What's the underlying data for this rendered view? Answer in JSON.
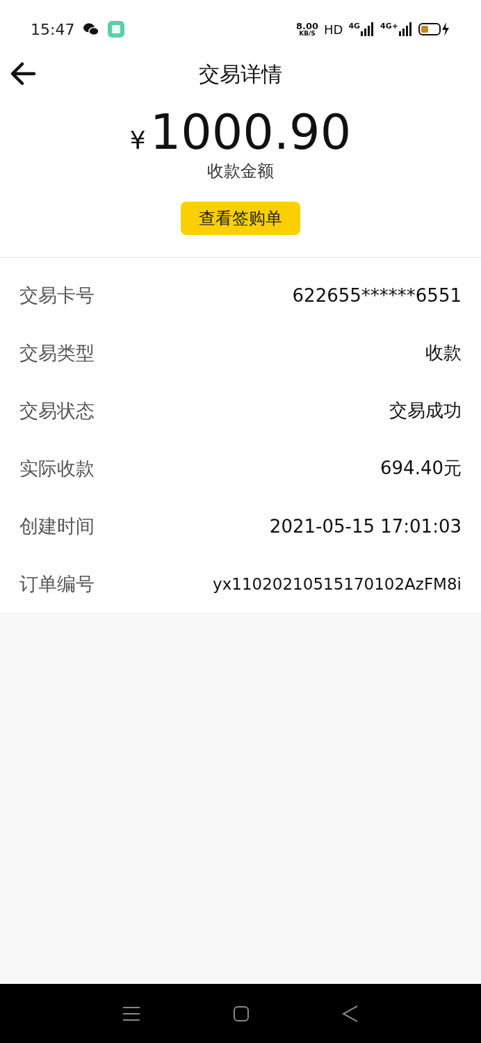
{
  "status_bar": {
    "time": "15:47",
    "speed": "8.00",
    "speed_unit": "KB/S",
    "hd": "HD",
    "network_1": "4G",
    "network_2": "4G+"
  },
  "header": {
    "title": "交易详情"
  },
  "amount": {
    "currency": "¥",
    "value": "1000.90",
    "label": "收款金额",
    "button": "查看签购单"
  },
  "details": [
    {
      "label": "交易卡号",
      "value": "622655******6551"
    },
    {
      "label": "交易类型",
      "value": "收款"
    },
    {
      "label": "交易状态",
      "value": "交易成功"
    },
    {
      "label": "实际收款",
      "value": "694.40元"
    },
    {
      "label": "创建时间",
      "value": "2021-05-15 17:01:03"
    },
    {
      "label": "订单编号",
      "value": "yx11020210515170102AzFM8i"
    }
  ]
}
